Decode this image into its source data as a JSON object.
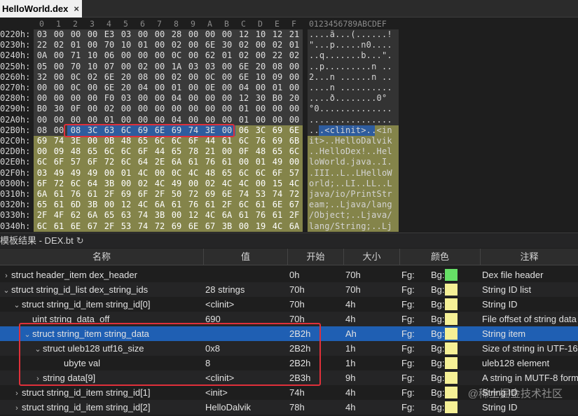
{
  "tab": {
    "title": "HelloWorld.dex",
    "close": "×"
  },
  "hex": {
    "col_headers": [
      "0",
      "1",
      "2",
      "3",
      "4",
      "5",
      "6",
      "7",
      "8",
      "9",
      "A",
      "B",
      "C",
      "D",
      "E",
      "F"
    ],
    "ascii_header": "0123456789ABCDEF",
    "rows": [
      {
        "addr": "0220h:",
        "bytes": [
          "03",
          "00",
          "00",
          "00",
          "E3",
          "03",
          "00",
          "00",
          "28",
          "00",
          "00",
          "00",
          "12",
          "10",
          "12",
          "21"
        ],
        "ascii": "....ã...(......!",
        "bg": "gray"
      },
      {
        "addr": "0230h:",
        "bytes": [
          "22",
          "02",
          "01",
          "00",
          "70",
          "10",
          "01",
          "00",
          "02",
          "00",
          "6E",
          "30",
          "02",
          "00",
          "02",
          "01"
        ],
        "ascii": "\"...p.....n0....",
        "bg": "gray"
      },
      {
        "addr": "0240h:",
        "bytes": [
          "0A",
          "00",
          "71",
          "10",
          "06",
          "00",
          "00",
          "00",
          "0C",
          "00",
          "62",
          "01",
          "02",
          "00",
          "22",
          "02"
        ],
        "ascii": "..q.......b...\".",
        "bg": "gray"
      },
      {
        "addr": "0250h:",
        "bytes": [
          "05",
          "00",
          "70",
          "10",
          "07",
          "00",
          "02",
          "00",
          "1A",
          "03",
          "03",
          "00",
          "6E",
          "20",
          "08",
          "00"
        ],
        "ascii": "..p.........n ..",
        "bg": "gray"
      },
      {
        "addr": "0260h:",
        "bytes": [
          "32",
          "00",
          "0C",
          "02",
          "6E",
          "20",
          "08",
          "00",
          "02",
          "00",
          "0C",
          "00",
          "6E",
          "10",
          "09",
          "00"
        ],
        "ascii": "2...n ......n ..",
        "bg": "gray"
      },
      {
        "addr": "0270h:",
        "bytes": [
          "00",
          "00",
          "0C",
          "00",
          "6E",
          "20",
          "04",
          "00",
          "01",
          "00",
          "0E",
          "00",
          "04",
          "00",
          "01",
          "00"
        ],
        "ascii": "....n ..........",
        "bg": "gray"
      },
      {
        "addr": "0280h:",
        "bytes": [
          "00",
          "00",
          "00",
          "00",
          "F0",
          "03",
          "00",
          "00",
          "04",
          "00",
          "00",
          "00",
          "12",
          "30",
          "B0",
          "20"
        ],
        "ascii": "....ð........0° ",
        "bg": "gray"
      },
      {
        "addr": "0290h:",
        "bytes": [
          "B0",
          "30",
          "0F",
          "00",
          "02",
          "00",
          "00",
          "00",
          "00",
          "00",
          "00",
          "00",
          "01",
          "00",
          "00",
          "00"
        ],
        "ascii": "°0..............",
        "bg": "gray"
      },
      {
        "addr": "02A0h:",
        "bytes": [
          "00",
          "00",
          "00",
          "00",
          "01",
          "00",
          "00",
          "00",
          "04",
          "00",
          "00",
          "00",
          "01",
          "00",
          "00",
          "00"
        ],
        "ascii": "................",
        "bg": "gray"
      },
      {
        "addr": "02B0h:",
        "bytes": [
          "08",
          "00",
          "08",
          "3C",
          "63",
          "6C",
          "69",
          "6E",
          "69",
          "74",
          "3E",
          "00",
          "06",
          "3C",
          "69",
          "6E"
        ],
        "ascii": "...<clinit>..<in",
        "bg": "mixed"
      },
      {
        "addr": "02C0h:",
        "bytes": [
          "69",
          "74",
          "3E",
          "00",
          "0B",
          "48",
          "65",
          "6C",
          "6C",
          "6F",
          "44",
          "61",
          "6C",
          "76",
          "69",
          "6B"
        ],
        "ascii": "it>..HelloDalvik",
        "bg": "olive"
      },
      {
        "addr": "02D0h:",
        "bytes": [
          "00",
          "09",
          "48",
          "65",
          "6C",
          "6C",
          "6F",
          "44",
          "65",
          "78",
          "21",
          "00",
          "0F",
          "48",
          "65",
          "6C"
        ],
        "ascii": "..HelloDex!..Hel",
        "bg": "olive"
      },
      {
        "addr": "02E0h:",
        "bytes": [
          "6C",
          "6F",
          "57",
          "6F",
          "72",
          "6C",
          "64",
          "2E",
          "6A",
          "61",
          "76",
          "61",
          "00",
          "01",
          "49",
          "00"
        ],
        "ascii": "loWorld.java..I.",
        "bg": "olive"
      },
      {
        "addr": "02F0h:",
        "bytes": [
          "03",
          "49",
          "49",
          "49",
          "00",
          "01",
          "4C",
          "00",
          "0C",
          "4C",
          "48",
          "65",
          "6C",
          "6C",
          "6F",
          "57"
        ],
        "ascii": ".III..L..LHelloW",
        "bg": "olive"
      },
      {
        "addr": "0300h:",
        "bytes": [
          "6F",
          "72",
          "6C",
          "64",
          "3B",
          "00",
          "02",
          "4C",
          "49",
          "00",
          "02",
          "4C",
          "4C",
          "00",
          "15",
          "4C"
        ],
        "ascii": "orld;..LI..LL..L",
        "bg": "olive"
      },
      {
        "addr": "0310h:",
        "bytes": [
          "6A",
          "61",
          "76",
          "61",
          "2F",
          "69",
          "6F",
          "2F",
          "50",
          "72",
          "69",
          "6E",
          "74",
          "53",
          "74",
          "72"
        ],
        "ascii": "java/io/PrintStr",
        "bg": "olive"
      },
      {
        "addr": "0320h:",
        "bytes": [
          "65",
          "61",
          "6D",
          "3B",
          "00",
          "12",
          "4C",
          "6A",
          "61",
          "76",
          "61",
          "2F",
          "6C",
          "61",
          "6E",
          "67"
        ],
        "ascii": "eam;..Ljava/lang",
        "bg": "olive"
      },
      {
        "addr": "0330h:",
        "bytes": [
          "2F",
          "4F",
          "62",
          "6A",
          "65",
          "63",
          "74",
          "3B",
          "00",
          "12",
          "4C",
          "6A",
          "61",
          "76",
          "61",
          "2F"
        ],
        "ascii": "/Object;..Ljava/",
        "bg": "olive"
      },
      {
        "addr": "0340h:",
        "bytes": [
          "6C",
          "61",
          "6E",
          "67",
          "2F",
          "53",
          "74",
          "72",
          "69",
          "6E",
          "67",
          "3B",
          "00",
          "19",
          "4C",
          "6A"
        ],
        "ascii": "lang/String;..Lj",
        "bg": "olive"
      }
    ]
  },
  "template_bar": {
    "label": "模板结果 - DEX.bt",
    "refresh_icon": "↻"
  },
  "table": {
    "headers": [
      "名称",
      "值",
      "开始",
      "大小",
      "颜色",
      "注释"
    ],
    "rows": [
      {
        "arrow": "›",
        "indent": 0,
        "name": "struct header_item dex_header",
        "value": "",
        "start": "0h",
        "size": "70h",
        "fg": "Fg:",
        "bg": "Bg:",
        "swatch": "green",
        "note": "Dex file header"
      },
      {
        "arrow": "⌄",
        "indent": 0,
        "name": "struct string_id_list dex_string_ids",
        "value": "28 strings",
        "start": "70h",
        "size": "70h",
        "fg": "Fg:",
        "bg": "Bg:",
        "swatch": "yellow",
        "note": "String ID list"
      },
      {
        "arrow": "⌄",
        "indent": 1,
        "name": "struct string_id_item string_id[0]",
        "value": "<clinit>",
        "start": "70h",
        "size": "4h",
        "fg": "Fg:",
        "bg": "Bg:",
        "swatch": "yellow",
        "note": "String ID"
      },
      {
        "arrow": "",
        "indent": 2,
        "name": "uint string_data_off",
        "value": "690",
        "start": "70h",
        "size": "4h",
        "fg": "Fg:",
        "bg": "Bg:",
        "swatch": "yellow",
        "note": "File offset of string data"
      },
      {
        "arrow": "⌄",
        "indent": 2,
        "name": "struct string_item string_data",
        "value": "",
        "start": "2B2h",
        "size": "Ah",
        "fg": "Fg:",
        "bg": "Bg:",
        "swatch": "yellow",
        "note": "String item",
        "selected": true
      },
      {
        "arrow": "⌄",
        "indent": 3,
        "name": "struct uleb128 utf16_size",
        "value": "0x8",
        "start": "2B2h",
        "size": "1h",
        "fg": "Fg:",
        "bg": "Bg:",
        "swatch": "yellow",
        "note": "Size of string in UTF-16"
      },
      {
        "arrow": "",
        "indent": 5,
        "name": "ubyte val",
        "value": "8",
        "start": "2B2h",
        "size": "1h",
        "fg": "Fg:",
        "bg": "Bg:",
        "swatch": "yellow",
        "note": "uleb128 element"
      },
      {
        "arrow": "›",
        "indent": 3,
        "name": "string data[9]",
        "value": "<clinit>",
        "start": "2B3h",
        "size": "9h",
        "fg": "Fg:",
        "bg": "Bg:",
        "swatch": "yellow",
        "note": "A string in MUTF-8 form"
      },
      {
        "arrow": "›",
        "indent": 1,
        "name": "struct string_id_item string_id[1]",
        "value": "<init>",
        "start": "74h",
        "size": "4h",
        "fg": "Fg:",
        "bg": "Bg:",
        "swatch": "yellow",
        "note": "String ID"
      },
      {
        "arrow": "›",
        "indent": 1,
        "name": "struct string_id_item string_id[2]",
        "value": "HelloDalvik",
        "start": "78h",
        "size": "4h",
        "fg": "Fg:",
        "bg": "Bg:",
        "swatch": "yellow",
        "note": "String ID"
      }
    ]
  },
  "watermark": "@稀土掘金技术社区",
  "colors": {
    "selection": "#1f5fb3",
    "highlight_box": "#e0303a",
    "string_bg": "#84844a",
    "swatch_green": "#66e066",
    "swatch_yellow": "#f5f096"
  }
}
